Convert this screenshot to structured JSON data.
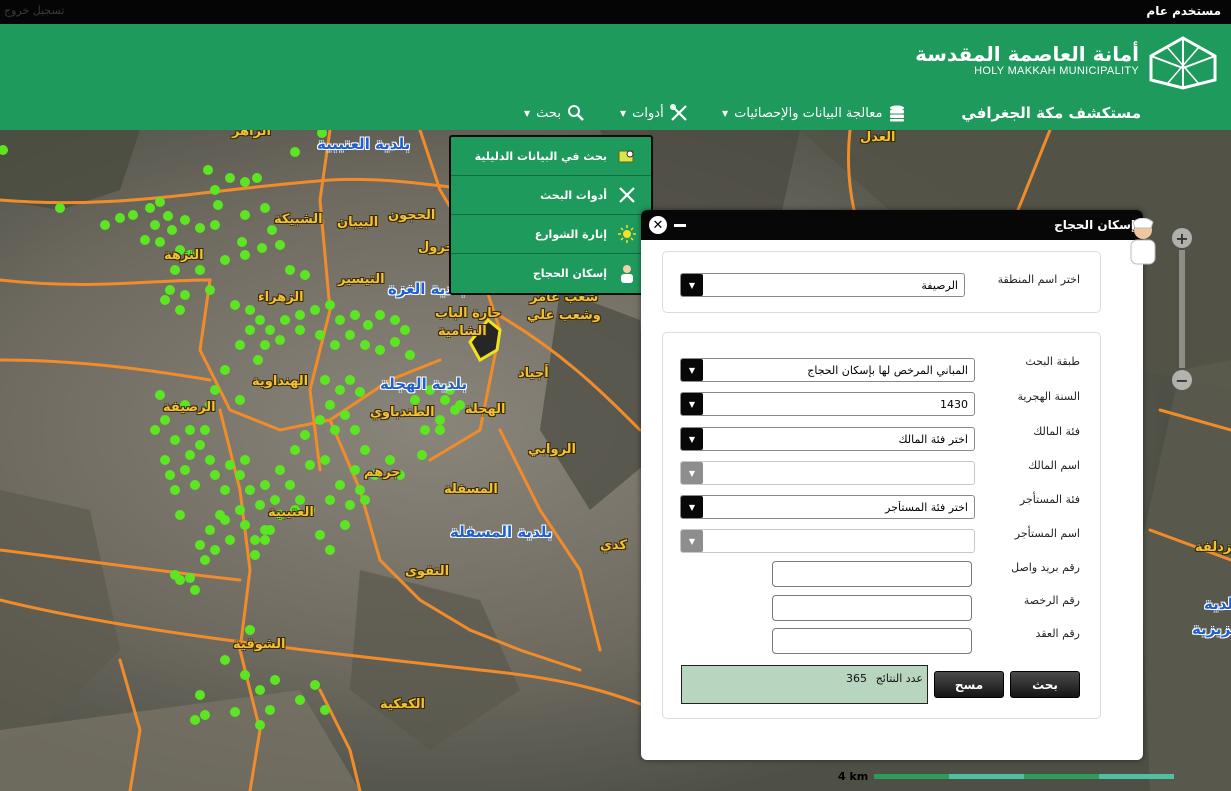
{
  "topbar": {
    "user": "مستخدم عام",
    "logout": "تسجيل خروج"
  },
  "header": {
    "brand_ar": "أمانة العاصمة المقدسة",
    "brand_en": "HOLY MAKKAH MUNICIPALITY",
    "app_title": "مستكشف مكة الجغرافي",
    "nav": [
      {
        "label": "معالجة البيانات والإحصائيات",
        "icon": "database-icon"
      },
      {
        "label": "أدوات",
        "icon": "tools-icon"
      },
      {
        "label": "بحث",
        "icon": "search-icon"
      }
    ],
    "accent": "#1f9a5d"
  },
  "dropdown": {
    "items": [
      {
        "label": "بحث في البيانات الدليلية",
        "icon": "map-search-icon"
      },
      {
        "label": "أدوات البحث",
        "icon": "tools-icon"
      },
      {
        "label": "إنارة الشوارع",
        "icon": "sun-icon"
      },
      {
        "label": "إسكان الحجاج",
        "icon": "person-icon"
      }
    ]
  },
  "map_labels": [
    "بلدية العتيبية",
    "الزاهر",
    "الحجون",
    "البيبان",
    "جرول",
    "الشبيكة",
    "التيسير",
    "بلدية الغزة",
    "الزهراء",
    "حارة الباب",
    "الشامية",
    "شعب عامر",
    "وشعب علي",
    "أجياد",
    "النزهة",
    "الهنداوية",
    "بلدية الهجلة",
    "الرصيفة",
    "الطندباوي",
    "الهجلة",
    "الروابي",
    "جرهم",
    "المسفلة",
    "العتيبية",
    "بلدية المسفلة",
    "كدي",
    "التقوى",
    "الشوقية",
    "الكعكية",
    "العدل",
    "مزدلفة",
    "بلدية",
    "العزيزية"
  ],
  "dialog": {
    "title": "إسكان الحجاج",
    "region_label": "اختر اسم المنطقة",
    "region_value": "الرصيفة",
    "search_layer_label": "طبقة البحث",
    "search_layer_value": "المباني المرخص لها بإسكان الحجاج",
    "hijri_year_label": "السنة الهجرية",
    "hijri_year_value": "1430",
    "owner_category_label": "فئة المالك",
    "owner_category_value": "اختر  فئة المالك",
    "owner_name_label": "اسم المالك",
    "tenant_category_label": "فئة المستأجر",
    "tenant_category_value": "اختر  فئة المستأجر",
    "tenant_name_label": "اسم المستأجر",
    "mail_label": "رقم بريد واصل",
    "license_label": "رقم الرخصة",
    "contract_label": "رقم العقد",
    "search_button": "بحث",
    "clear_button": "مسح",
    "result_label": "عدد النتائج",
    "result_count": "365"
  },
  "scale": {
    "label": "4 km"
  }
}
